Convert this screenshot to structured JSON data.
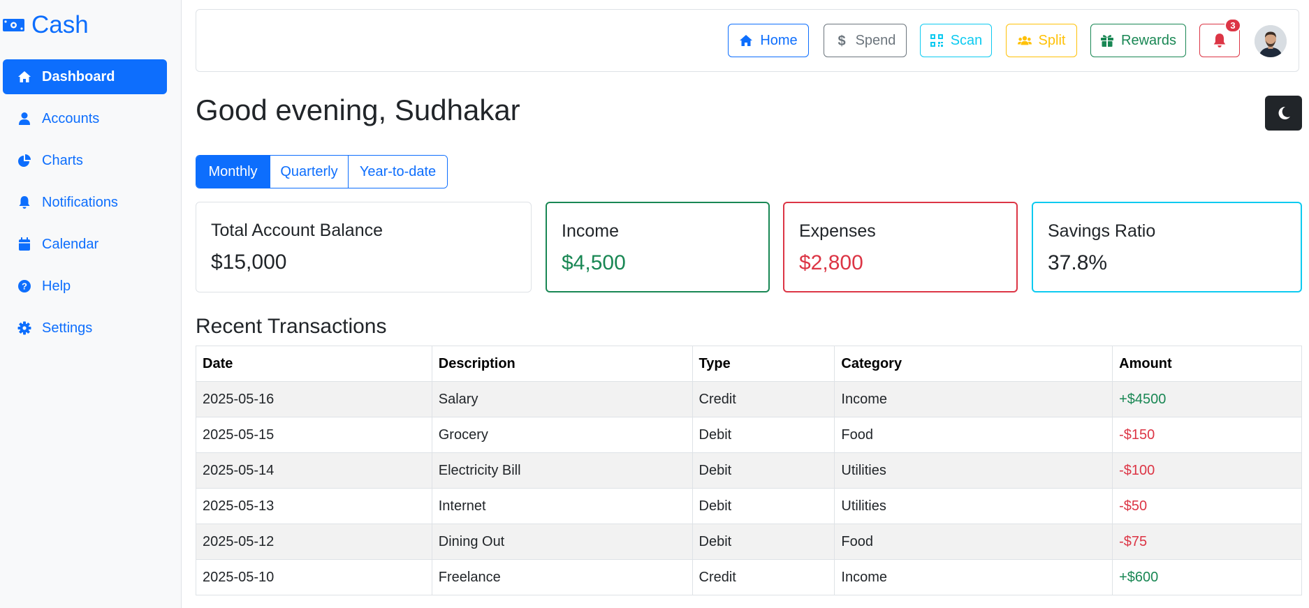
{
  "brand": {
    "name": "Cash",
    "icon": "money-bill-icon"
  },
  "sidebar": {
    "items": [
      {
        "label": "Dashboard",
        "icon": "home-icon",
        "active": true
      },
      {
        "label": "Accounts",
        "icon": "user-icon"
      },
      {
        "label": "Charts",
        "icon": "pie-chart-icon"
      },
      {
        "label": "Notifications",
        "icon": "bell-icon"
      },
      {
        "label": "Calendar",
        "icon": "calendar-icon"
      },
      {
        "label": "Help",
        "icon": "question-circle-icon"
      },
      {
        "label": "Settings",
        "icon": "gear-icon"
      }
    ]
  },
  "topbar": {
    "home": "Home",
    "spend": "Spend",
    "scan": "Scan",
    "split": "Split",
    "rewards": "Rewards",
    "notification_count": "3"
  },
  "greeting": "Good evening, Sudhakar",
  "periods": [
    "Monthly",
    "Quarterly",
    "Year-to-date"
  ],
  "active_period": "Monthly",
  "cards": {
    "balance": {
      "title": "Total Account Balance",
      "value": "$15,000"
    },
    "income": {
      "title": "Income",
      "value": "$4,500"
    },
    "expenses": {
      "title": "Expenses",
      "value": "$2,800"
    },
    "savings": {
      "title": "Savings Ratio",
      "value": "37.8%"
    }
  },
  "transactions": {
    "title": "Recent Transactions",
    "headers": [
      "Date",
      "Description",
      "Type",
      "Category",
      "Amount"
    ],
    "rows": [
      {
        "date": "2025-05-16",
        "description": "Salary",
        "type": "Credit",
        "category": "Income",
        "amount": "+$4500"
      },
      {
        "date": "2025-05-15",
        "description": "Grocery",
        "type": "Debit",
        "category": "Food",
        "amount": "-$150"
      },
      {
        "date": "2025-05-14",
        "description": "Electricity Bill",
        "type": "Debit",
        "category": "Utilities",
        "amount": "-$100"
      },
      {
        "date": "2025-05-13",
        "description": "Internet",
        "type": "Debit",
        "category": "Utilities",
        "amount": "-$50"
      },
      {
        "date": "2025-05-12",
        "description": "Dining Out",
        "type": "Debit",
        "category": "Food",
        "amount": "-$75"
      },
      {
        "date": "2025-05-10",
        "description": "Freelance",
        "type": "Credit",
        "category": "Income",
        "amount": "+$600"
      }
    ]
  },
  "colors": {
    "primary": "#0d6efd",
    "success": "#198754",
    "danger": "#dc3545",
    "info": "#0dcaf0",
    "warning": "#ffc107",
    "secondary": "#6c757d",
    "dark": "#212529"
  }
}
